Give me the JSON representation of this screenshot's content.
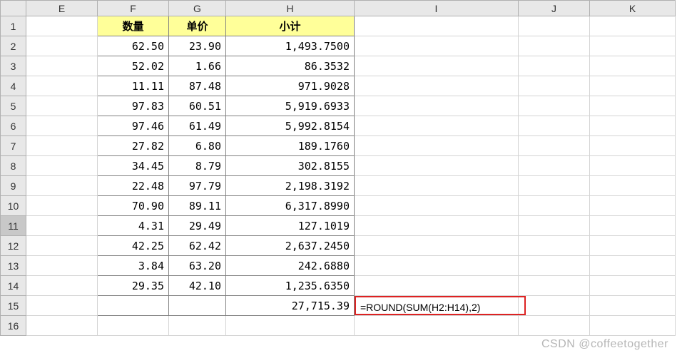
{
  "columns": [
    "E",
    "F",
    "G",
    "H",
    "I",
    "J",
    "K"
  ],
  "headers": {
    "F": "数量",
    "G": "单价",
    "H": "小计"
  },
  "rows": [
    {
      "n": 1
    },
    {
      "n": 2,
      "F": "62.50",
      "G": "23.90",
      "H": "1,493.7500"
    },
    {
      "n": 3,
      "F": "52.02",
      "G": "1.66",
      "H": "86.3532"
    },
    {
      "n": 4,
      "F": "11.11",
      "G": "87.48",
      "H": "971.9028"
    },
    {
      "n": 5,
      "F": "97.83",
      "G": "60.51",
      "H": "5,919.6933"
    },
    {
      "n": 6,
      "F": "97.46",
      "G": "61.49",
      "H": "5,992.8154"
    },
    {
      "n": 7,
      "F": "27.82",
      "G": "6.80",
      "H": "189.1760"
    },
    {
      "n": 8,
      "F": "34.45",
      "G": "8.79",
      "H": "302.8155"
    },
    {
      "n": 9,
      "F": "22.48",
      "G": "97.79",
      "H": "2,198.3192"
    },
    {
      "n": 10,
      "F": "70.90",
      "G": "89.11",
      "H": "6,317.8990"
    },
    {
      "n": 11,
      "F": "4.31",
      "G": "29.49",
      "H": "127.1019"
    },
    {
      "n": 12,
      "F": "42.25",
      "G": "62.42",
      "H": "2,637.2450"
    },
    {
      "n": 13,
      "F": "3.84",
      "G": "63.20",
      "H": "242.6880"
    },
    {
      "n": 14,
      "F": "29.35",
      "G": "42.10",
      "H": "1,235.6350"
    },
    {
      "n": 15,
      "H": "27,715.39",
      "I": "=ROUND(SUM(H2:H14),2)"
    },
    {
      "n": 16
    }
  ],
  "selected_row": 11,
  "watermark": "CSDN @coffeetogether",
  "chart_data": {
    "type": "table",
    "title": "",
    "columns": [
      "数量",
      "单价",
      "小计"
    ],
    "rows": [
      [
        62.5,
        23.9,
        1493.75
      ],
      [
        52.02,
        1.66,
        86.3532
      ],
      [
        11.11,
        87.48,
        971.9028
      ],
      [
        97.83,
        60.51,
        5919.6933
      ],
      [
        97.46,
        61.49,
        5992.8154
      ],
      [
        27.82,
        6.8,
        189.176
      ],
      [
        34.45,
        8.79,
        302.8155
      ],
      [
        22.48,
        97.79,
        2198.3192
      ],
      [
        70.9,
        89.11,
        6317.899
      ],
      [
        4.31,
        29.49,
        127.1019
      ],
      [
        42.25,
        62.42,
        2637.245
      ],
      [
        3.84,
        63.2,
        242.688
      ],
      [
        29.35,
        42.1,
        1235.635
      ]
    ],
    "total_H": 27715.39,
    "formula": "=ROUND(SUM(H2:H14),2)"
  }
}
